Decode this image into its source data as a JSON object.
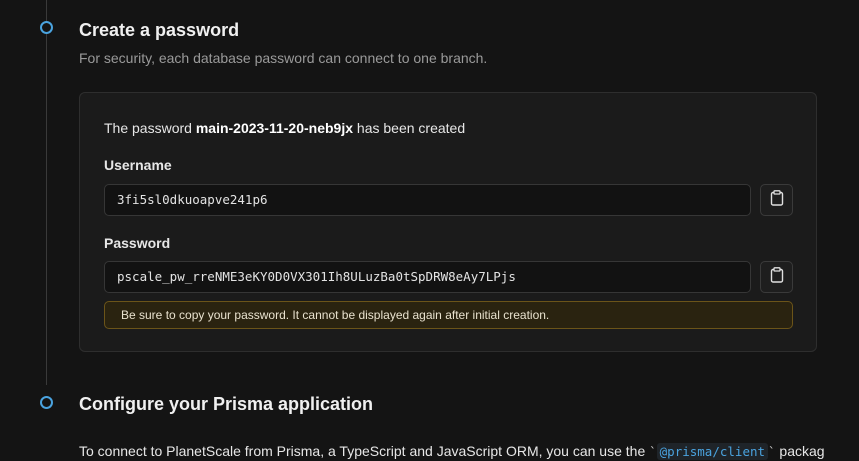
{
  "step1": {
    "title": "Create a password",
    "subtitle": "For security, each database password can connect to one branch."
  },
  "card": {
    "created_prefix": "The password ",
    "password_name": "main-2023-11-20-neb9jx",
    "created_suffix": " has been created",
    "username_label": "Username",
    "username_value": "3fi5sl0dkuoapve241p6",
    "password_label": "Password",
    "password_value": "pscale_pw_rreNME3eKY0D0VX301Ih8ULuzBa0tSpDRW8eAy7LPjs",
    "warning": "Be sure to copy your password. It cannot be displayed again after initial creation."
  },
  "step2": {
    "title": "Configure your Prisma application",
    "text_prefix": "To connect to PlanetScale from Prisma, a TypeScript and JavaScript ORM, you can use the ",
    "code_open": "`",
    "code": "@prisma/client",
    "code_close": "`",
    "text_suffix": " packag"
  },
  "icons": {
    "copy": "clipboard-icon",
    "step": "step-circle-icon"
  },
  "colors": {
    "accent": "#4aa3df",
    "warning_bg": "#2a2310",
    "warning_border": "#6b5419"
  }
}
